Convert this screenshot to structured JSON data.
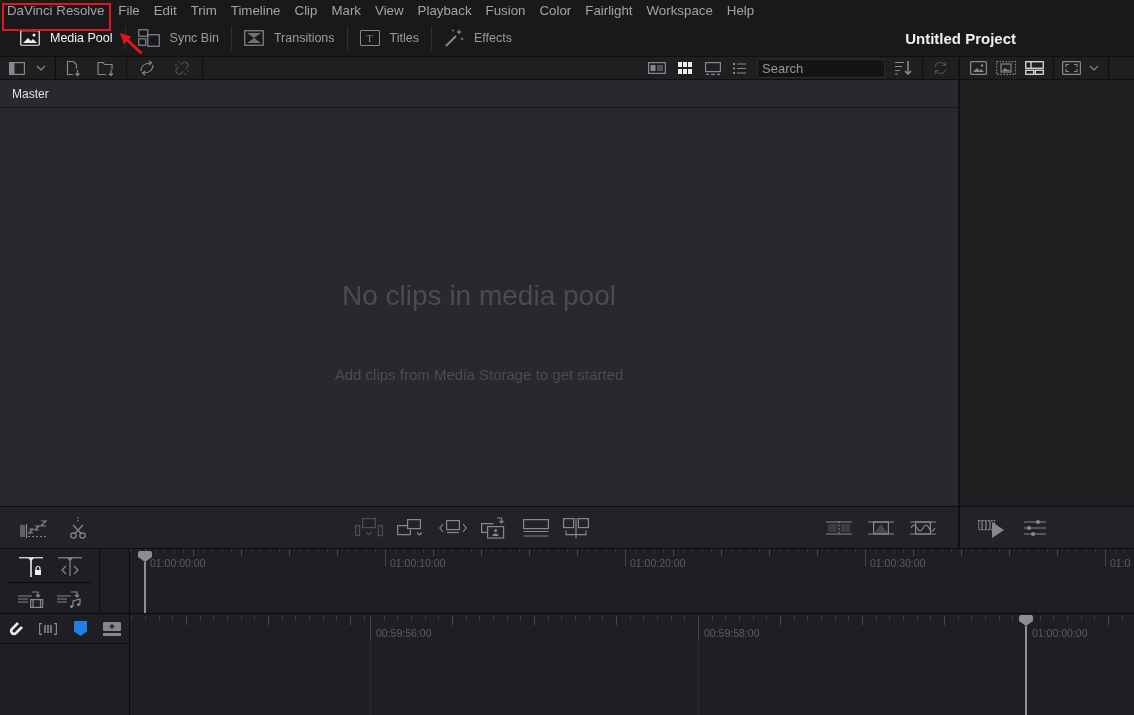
{
  "menu_bar": {
    "items": [
      {
        "label": "DaVinci Resolve",
        "highlighted": true
      },
      {
        "label": "File",
        "highlighted": false
      },
      {
        "label": "Edit",
        "highlighted": false
      },
      {
        "label": "Trim",
        "highlighted": false
      },
      {
        "label": "Timeline",
        "highlighted": false
      },
      {
        "label": "Clip",
        "highlighted": false
      },
      {
        "label": "Mark",
        "highlighted": false
      },
      {
        "label": "View",
        "highlighted": false
      },
      {
        "label": "Playback",
        "highlighted": false
      },
      {
        "label": "Fusion",
        "highlighted": false
      },
      {
        "label": "Color",
        "highlighted": false
      },
      {
        "label": "Fairlight",
        "highlighted": false
      },
      {
        "label": "Workspace",
        "highlighted": false
      },
      {
        "label": "Help",
        "highlighted": false
      }
    ]
  },
  "toolbar": {
    "panels": [
      {
        "kind": "media",
        "label": "Media Pool",
        "selected": true
      },
      {
        "kind": "sync",
        "label": "Sync Bin",
        "selected": false
      },
      {
        "kind": "transitions",
        "label": "Transitions",
        "selected": false
      },
      {
        "kind": "titles",
        "glyph": "T",
        "label": "Titles",
        "selected": false
      },
      {
        "kind": "effects",
        "label": "Effects",
        "selected": false
      }
    ],
    "project_title": "Untitled Project"
  },
  "pool_toolbar": {
    "tool_groups": [
      [
        {
          "kind": "import-media",
          "disabled": false
        },
        {
          "kind": "import-folder",
          "disabled": false
        }
      ],
      [
        {
          "kind": "sync",
          "disabled": false
        },
        {
          "kind": "unlink",
          "disabled": true
        }
      ]
    ],
    "view_modes": [
      {
        "kind": "metadata",
        "selected": false
      },
      {
        "kind": "thumbnail",
        "selected": true
      },
      {
        "kind": "filmstrip",
        "selected": false
      },
      {
        "kind": "list",
        "selected": false
      }
    ],
    "search": {
      "placeholder": "Search"
    },
    "sort": {
      "disabled": false
    },
    "refresh": {
      "disabled": true
    }
  },
  "bin": {
    "name": "Master"
  },
  "media_pool": {
    "empty_title": "No clips in media pool",
    "empty_hint": "Add clips from Media Storage to get started"
  },
  "viewer_toolbar": {
    "modes": [
      {
        "kind": "image",
        "selected": false
      },
      {
        "kind": "dashed-image",
        "selected": false
      },
      {
        "kind": "tiles",
        "selected": true
      }
    ]
  },
  "edit_toolbar": {
    "actions": [
      {
        "kind": "smart-insert",
        "disabled": true
      },
      {
        "kind": "insert",
        "disabled": false
      },
      {
        "kind": "overwrite",
        "disabled": false
      },
      {
        "kind": "place-on-top",
        "disabled": false
      },
      {
        "kind": "append",
        "disabled": false
      },
      {
        "kind": "replace",
        "disabled": false
      }
    ]
  },
  "timeline": {
    "playhead_modes": [
      {
        "kind": "lock",
        "on": true
      },
      {
        "kind": "trim",
        "on": false
      }
    ],
    "append_tools": [
      {
        "kind": "append-video"
      },
      {
        "kind": "append-audio"
      }
    ],
    "track_tools": [
      {
        "kind": "snapping",
        "on": true
      },
      {
        "kind": "linked-selection",
        "on": false
      }
    ],
    "flag": {
      "color": "#1e80e6"
    },
    "upper_ruler": [
      {
        "label": "01:00:00:00",
        "playhead": true
      },
      {
        "label": "01:00:10:00",
        "playhead": false
      },
      {
        "label": "01:00:20:00",
        "playhead": false
      },
      {
        "label": "01:00:30:00",
        "playhead": false
      },
      {
        "label": "01:0",
        "playhead": false
      }
    ],
    "lower_ruler": [
      {
        "label": "00:59:56:00",
        "playhead": false
      },
      {
        "label": "00:59:58:00",
        "playhead": false
      },
      {
        "label": "01:00:00:00",
        "playhead": true
      }
    ]
  }
}
